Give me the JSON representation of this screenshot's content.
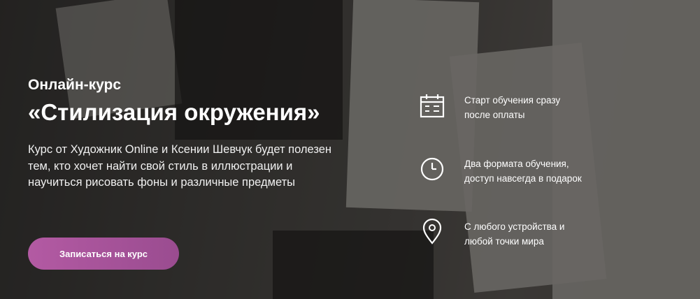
{
  "hero": {
    "subtitle": "Онлайн-курс",
    "title": "«Стилизация окружения»",
    "description": "Курс от Художник Online и Ксении Шевчук будет полезен тем, кто хочет найти свой стиль в иллюстрации и научиться рисовать фоны и различные предметы",
    "cta_label": "Записаться на курс",
    "cta_color": "#a8529a"
  },
  "features": [
    {
      "icon": "calendar-icon",
      "text": "Старт обучения сразу\nпосле оплаты"
    },
    {
      "icon": "clock-icon",
      "text": "Два формата обучения,\nдоступ навсегда в подарок"
    },
    {
      "icon": "location-pin-icon",
      "text": "С любого устройства и\nлюбой точки мира"
    }
  ]
}
